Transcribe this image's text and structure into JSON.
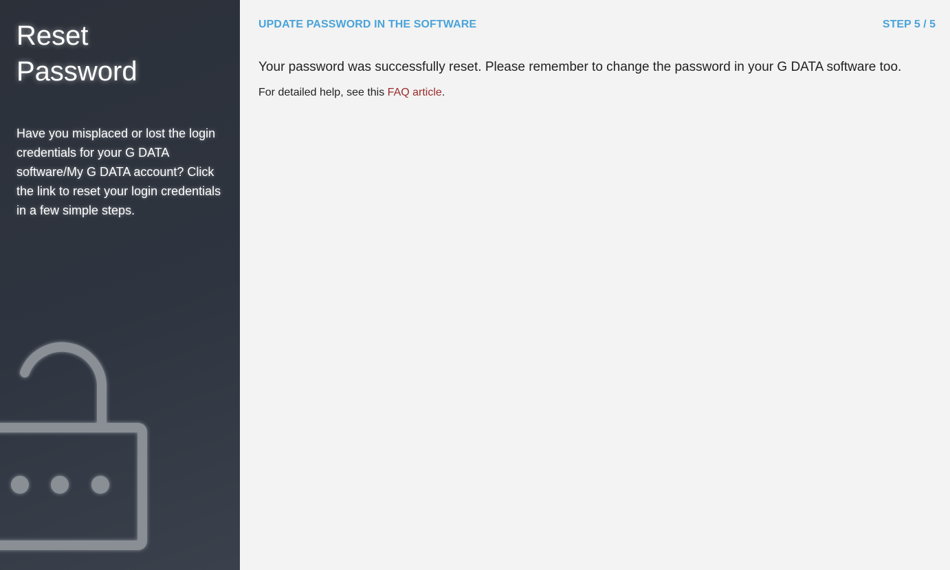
{
  "sidebar": {
    "title": "Reset Password",
    "description": "Have you misplaced or lost the login credentials for your G DATA software/My G DATA account? Click the link to reset your login credentials in a few simple steps.",
    "illustration_icon": "padlock-open-icon"
  },
  "main": {
    "step_heading": "UPDATE PASSWORD IN THE SOFTWARE",
    "step_counter": "STEP 5 / 5",
    "message": "Your password was successfully reset. Please remember to change the password in your G DATA software too.",
    "help_prefix": "For detailed help, see this ",
    "help_link_label": "FAQ article",
    "help_suffix": "."
  },
  "colors": {
    "accent": "#4aa3d8",
    "link": "#9b2b2b",
    "sidebar_bg": "#2f3540",
    "main_bg": "#f3f3f3"
  }
}
